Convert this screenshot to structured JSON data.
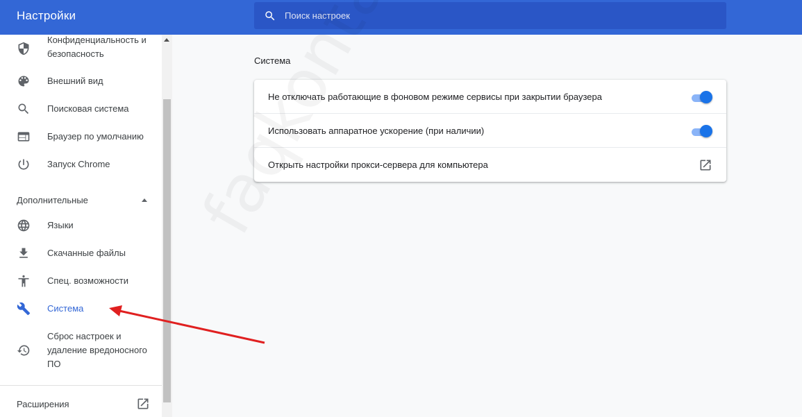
{
  "header": {
    "title": "Настройки",
    "search": {
      "placeholder": "Поиск настроек",
      "icon": "search-icon"
    },
    "background": "#3367d6"
  },
  "sidebar": {
    "items": [
      {
        "label": "Конфиденциальность и безопасность",
        "icon": "shield-icon"
      },
      {
        "label": "Внешний вид",
        "icon": "palette-icon"
      },
      {
        "label": "Поисковая система",
        "icon": "search-icon"
      },
      {
        "label": "Браузер по умолчанию",
        "icon": "browser-window-icon"
      },
      {
        "label": "Запуск Chrome",
        "icon": "power-icon"
      }
    ],
    "advanced_header": "Дополнительные",
    "advanced_items": [
      {
        "label": "Языки",
        "icon": "globe-icon"
      },
      {
        "label": "Скачанные файлы",
        "icon": "download-icon"
      },
      {
        "label": "Спец. возможности",
        "icon": "accessibility-icon"
      },
      {
        "label": "Система",
        "icon": "wrench-icon",
        "active": true
      },
      {
        "label": "Сброс настроек и удаление вредоносного ПО",
        "icon": "restore-icon"
      }
    ],
    "extensions": {
      "label": "Расширения",
      "icon": "open-in-new-icon"
    }
  },
  "main": {
    "section_title": "Система",
    "rows": [
      {
        "label": "Не отключать работающие в фоновом режиме сервисы при закрытии браузера",
        "control": "toggle",
        "on": true
      },
      {
        "label": "Использовать аппаратное ускорение (при наличии)",
        "control": "toggle",
        "on": true
      },
      {
        "label": "Открыть настройки прокси-сервера для компьютера",
        "control": "open-in-new-icon"
      }
    ]
  },
  "watermark": "faqkontakt.ru",
  "colors": {
    "accent": "#1a73e8",
    "active_text": "#3367d6",
    "annotation_arrow": "#e02020"
  }
}
